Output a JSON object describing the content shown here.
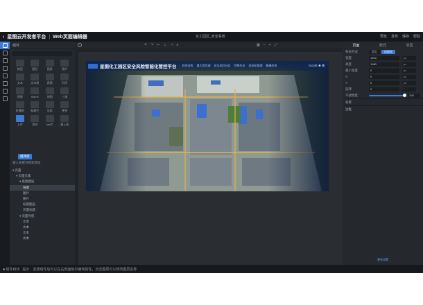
{
  "titlebar": {
    "brand": "星图云开发者平台",
    "separator": "|",
    "subtitle": "Web页面编辑器",
    "doc_title": "化工园区_安全系统",
    "actions": [
      "预览",
      "发布",
      "保存",
      "帮助"
    ]
  },
  "colors": {
    "accent": "#3a7bd5",
    "chrome": "#1f2227",
    "panel": "#25282d"
  },
  "left_panel": {
    "header": "组件",
    "components": [
      {
        "label": "按钮"
      },
      {
        "label": "图形"
      },
      {
        "label": "图表"
      },
      {
        "label": "图片"
      },
      {
        "label": "文本"
      },
      {
        "label": "文本框"
      },
      {
        "label": "表格"
      },
      {
        "label": "时间"
      },
      {
        "label": "视频"
      },
      {
        "label": "iframe"
      },
      {
        "label": "地图"
      },
      {
        "label": "三维"
      },
      {
        "label": "轮播图"
      },
      {
        "label": "标题栏"
      },
      {
        "label": "导航"
      },
      {
        "label": "更多"
      },
      {
        "label": "上传"
      },
      {
        "label": "滑块"
      },
      {
        "label": "tab栏"
      },
      {
        "label": "输入框"
      }
    ],
    "tooltip": "组件库",
    "layer_header": "输入关键词搜索图层",
    "tree": [
      {
        "label": "▾ 页面",
        "indent": 0
      },
      {
        "label": "▾ 页面元素",
        "indent": 1
      },
      {
        "label": "▾ 底图图层",
        "indent": 2
      },
      {
        "label": "背景",
        "indent": 3,
        "selected": true
      },
      {
        "label": "图片",
        "indent": 3
      },
      {
        "label": "图片",
        "indent": 3
      },
      {
        "label": "标题图层",
        "indent": 3
      },
      {
        "label": "页面标题",
        "indent": 3
      },
      {
        "label": "▾ 页面导航",
        "indent": 2
      },
      {
        "label": "文本",
        "indent": 3
      },
      {
        "label": "文本",
        "indent": 3
      },
      {
        "label": "文本",
        "indent": 3
      },
      {
        "label": "文本",
        "indent": 3
      }
    ]
  },
  "rail_icons": [
    "layers-icon",
    "component-icon",
    "page-icon",
    "data-icon",
    "image-icon",
    "text-icon",
    "setting-icon",
    "plugin-icon"
  ],
  "canvas": {
    "banner_title": "星图化工园区安全风险智能化管控平台",
    "nav_items": [
      "综合态势",
      "重大危险源",
      "安全风险分区",
      "特殊作业",
      "封闭化管理",
      "敏捷应急"
    ],
    "right_info": "2024年 ☀ 晴"
  },
  "right_panel": {
    "tabs": [
      "页面",
      "样式",
      "交互"
    ],
    "rows": [
      {
        "label": "布局方式",
        "value": "",
        "unit": ""
      },
      {
        "label": "宽度",
        "value": "1920",
        "unit": "px"
      },
      {
        "label": "高度",
        "value": "1080",
        "unit": "px"
      },
      {
        "label": "最小宽度",
        "value": "0",
        "unit": "px"
      },
      {
        "label": "X",
        "value": "0",
        "unit": "px"
      },
      {
        "label": "Y",
        "value": "0",
        "unit": "px"
      },
      {
        "label": "旋转",
        "value": "0",
        "unit": "°"
      }
    ],
    "segments": [
      "固定",
      "自适应"
    ],
    "opacity_label": "不透明度",
    "opacity_value": "100",
    "opacity": 1.0,
    "sections": [
      "背景",
      "边框"
    ],
    "footer": "更多设置"
  },
  "statusbar": {
    "left": "■ 组件树状",
    "hint": "提示：选择组件后可以在右侧面板中编辑属性，双击图层可以修改图层名称"
  }
}
